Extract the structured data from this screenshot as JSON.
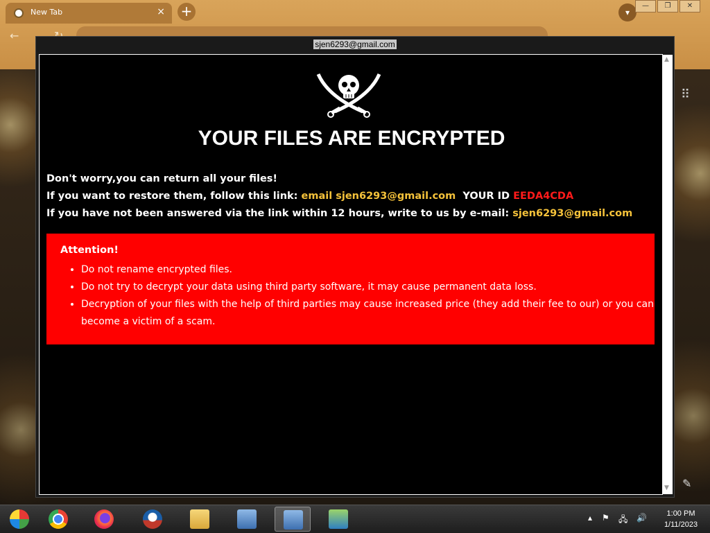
{
  "browser": {
    "tab_title": "New Tab",
    "tab_close": "×",
    "new_tab": "+"
  },
  "popup": {
    "title": "sjen6293@gmail.com",
    "headline": "YOUR FILES ARE ENCRYPTED",
    "line1": "Don't worry,you can return all your files!",
    "line2_prefix": "If you want to restore them, follow this link: ",
    "line2_email": "email sjen6293@gmail.com",
    "line2_id_label": "  YOUR ID ",
    "line2_id": "EEDA4CDA",
    "line3_prefix": "If you have not been answered via the link within 12 hours, write to us by e-mail: ",
    "line3_email": "sjen6293@gmail.com",
    "attention_title": "Attention!",
    "attention_items": [
      "Do not rename encrypted files.",
      "Do not try to decrypt your data using third party software, it may cause permanent data loss.",
      "Decryption of your files with the help of third parties may cause increased price (they add their fee to our) or you can become a victim of a scam."
    ]
  },
  "taskbar": {
    "time": "1:00 PM",
    "date": "1/11/2023"
  },
  "colors": {
    "headline": "#ffffff",
    "email_highlight": "#f5c23a",
    "id_highlight": "#ff1a1a",
    "attention_bg": "#ff0000"
  }
}
